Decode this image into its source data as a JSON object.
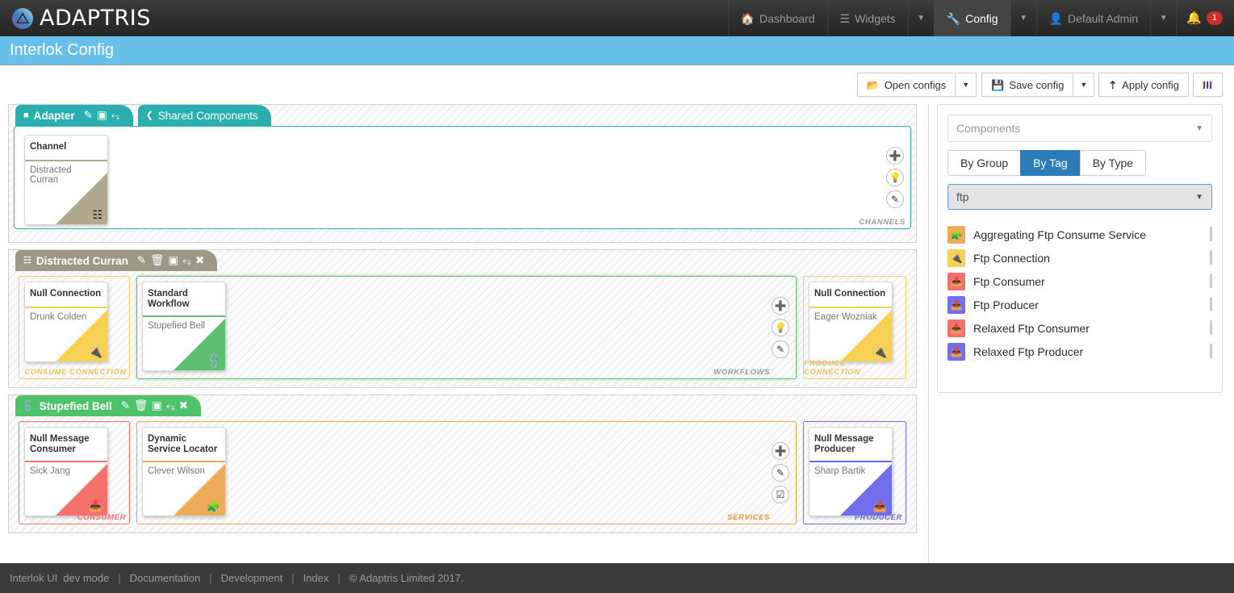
{
  "brand": {
    "name": "ADAPTRIS",
    "logo_icon": "adaptris-logo-icon"
  },
  "topnav": {
    "items": [
      {
        "label": "Dashboard",
        "icon": "home-icon",
        "active": false
      },
      {
        "label": "Widgets",
        "icon": "list-icon",
        "active": false
      },
      {
        "label": "Config",
        "icon": "wrench-icon",
        "active": true
      },
      {
        "label": "Default Admin",
        "icon": "user-icon",
        "active": false
      }
    ],
    "caret_icon": "chevron-down-icon",
    "bell_icon": "bell-icon",
    "notification_count": "1"
  },
  "page": {
    "title": "Interlok Config"
  },
  "toolbar": {
    "open_configs_label": "Open configs",
    "open_configs_icon": "folder-open-icon",
    "save_config_label": "Save config",
    "save_config_icon": "floppy-disk-icon",
    "apply_config_label": "Apply config",
    "apply_config_icon": "upload-arrow-icon",
    "columns_icon": "columns-icon",
    "caret_icon": "chevron-down-icon"
  },
  "adapter_panel": {
    "tabs": [
      {
        "label": "Adapter",
        "icon": "adapter-icon",
        "active": true,
        "actions": [
          "edit-icon",
          "collapse-icon",
          "shrink-icon"
        ]
      },
      {
        "label": "Shared Components",
        "icon": "share-icon",
        "active": false,
        "actions": []
      }
    ],
    "category_label": "CHANNELS",
    "category_color": "#9a9a9a",
    "actions": [
      "plus-icon",
      "lightbulb-icon",
      "edit-icon"
    ],
    "nodes": [
      {
        "type": "Channel",
        "name": "Distracted Curran",
        "icon": "sitemap-icon",
        "color": "#b0a98f",
        "accent": "#9d9886"
      }
    ]
  },
  "channel_panel": {
    "title": "Distracted Curran",
    "icon": "sitemap-icon",
    "header_color": "#9d9886",
    "actions": [
      "edit-icon",
      "trash-icon",
      "collapse-icon",
      "shrink-icon",
      "close-icon"
    ],
    "consume": {
      "category_label": "CONSUME CONNECTION",
      "category_color": "#e8c55b",
      "border_color": "#f0cf6a",
      "node": {
        "type": "Null Connection",
        "name": "Drunk Colden",
        "icon": "plug-icon",
        "color": "#f7d154"
      }
    },
    "workflows": {
      "category_label": "WORKFLOWS",
      "category_color": "#9a9a9a",
      "border_color": "#5cbf72",
      "actions": [
        "plus-icon",
        "lightbulb-icon",
        "edit-icon"
      ],
      "node": {
        "type": "Standard Workflow",
        "name": "Stupefied Bell",
        "icon": "chain-icon",
        "color": "#5cbf72"
      }
    },
    "produce": {
      "category_label": "PRODUCE CONNECTION",
      "category_color": "#e8c55b",
      "border_color": "#f0cf6a",
      "node": {
        "type": "Null Connection",
        "name": "Eager Wozniak",
        "icon": "plug-icon",
        "color": "#f7d154"
      }
    }
  },
  "workflow_panel": {
    "title": "Stupefied Bell",
    "icon": "chain-icon",
    "header_color": "#4fc26b",
    "actions": [
      "edit-icon",
      "trash-icon",
      "collapse-icon",
      "shrink-icon",
      "close-icon"
    ],
    "consumer": {
      "category_label": "CONSUMER",
      "category_color": "#f4706d",
      "border_color": "#f4706d",
      "node": {
        "type": "Null Message Consumer",
        "name": "Sick Jang",
        "icon": "download-icon",
        "color": "#f4706d"
      }
    },
    "services": {
      "category_label": "SERVICES",
      "category_color": "#e89a3c",
      "border_color": "#f0a94f",
      "actions": [
        "plus-icon",
        "edit-icon",
        "check-icon"
      ],
      "node": {
        "type": "Dynamic Service Locator",
        "name": "Clever Wilson",
        "icon": "puzzle-icon",
        "color": "#eeab5b"
      }
    },
    "producer": {
      "category_label": "PRODUCER",
      "category_color": "#6c6ce8",
      "border_color": "#6c6ce8",
      "node": {
        "type": "Null Message Producer",
        "name": "Sharp Bartik",
        "icon": "upload-icon",
        "color": "#7070ee"
      }
    }
  },
  "sidebar": {
    "components_placeholder": "Components",
    "caret_icon": "chevron-down-icon",
    "filter_tabs": [
      {
        "label": "By Group",
        "active": false
      },
      {
        "label": "By Tag",
        "active": true
      },
      {
        "label": "By Type",
        "active": false
      }
    ],
    "selected_tag": "ftp",
    "items": [
      {
        "label": "Aggregating Ftp Consume Service",
        "icon": "puzzle-icon",
        "color": "#eeab5b"
      },
      {
        "label": "Ftp Connection",
        "icon": "plug-icon",
        "color": "#f7d154"
      },
      {
        "label": "Ftp Consumer",
        "icon": "download-icon",
        "color": "#f4706d"
      },
      {
        "label": "Ftp Producer",
        "icon": "upload-icon",
        "color": "#7070ee"
      },
      {
        "label": "Relaxed Ftp Consumer",
        "icon": "download-icon",
        "color": "#f4706d"
      },
      {
        "label": "Relaxed Ftp Producer",
        "icon": "upload-icon",
        "color": "#7070ee"
      }
    ]
  },
  "footer": {
    "app": "Interlok UI",
    "mode": "dev mode",
    "links": [
      "Documentation",
      "Development",
      "Index"
    ],
    "copyright": "© Adaptris Limited 2017."
  }
}
